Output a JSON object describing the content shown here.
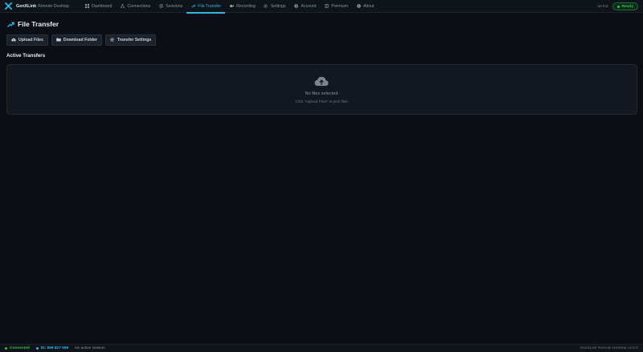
{
  "app": {
    "name": "GenXLink",
    "subtitle": "Remote Desktop",
    "version": "v2.0.0",
    "status": "Ready"
  },
  "nav": {
    "items": [
      {
        "label": "Dashboard",
        "icon": "dashboard-icon"
      },
      {
        "label": "Connections",
        "icon": "connections-icon"
      },
      {
        "label": "Sessions",
        "icon": "sessions-icon"
      },
      {
        "label": "File Transfer",
        "icon": "file-transfer-icon",
        "active": true
      },
      {
        "label": "Recording",
        "icon": "recording-icon"
      },
      {
        "label": "Settings",
        "icon": "gear-icon"
      },
      {
        "label": "Account",
        "icon": "account-icon"
      },
      {
        "label": "Premium",
        "icon": "premium-icon"
      },
      {
        "label": "About",
        "icon": "info-icon"
      }
    ]
  },
  "page": {
    "title": "File Transfer",
    "toolbar": {
      "upload_label": "Upload Files",
      "download_label": "Download Folder",
      "settings_label": "Transfer Settings"
    },
    "section_title": "Active Transfers",
    "empty": {
      "title": "No files selected",
      "hint": "Click \"Upload Files\" to pick files"
    }
  },
  "statusbar": {
    "connection": "Connected",
    "id": "ID: 869 827 559",
    "session": "No active session",
    "right": "GenXLink Remote Desktop v2.0.0"
  },
  "colors": {
    "background": "#0b0e14",
    "accent": "#2fb7e6",
    "success": "#3fb950"
  }
}
